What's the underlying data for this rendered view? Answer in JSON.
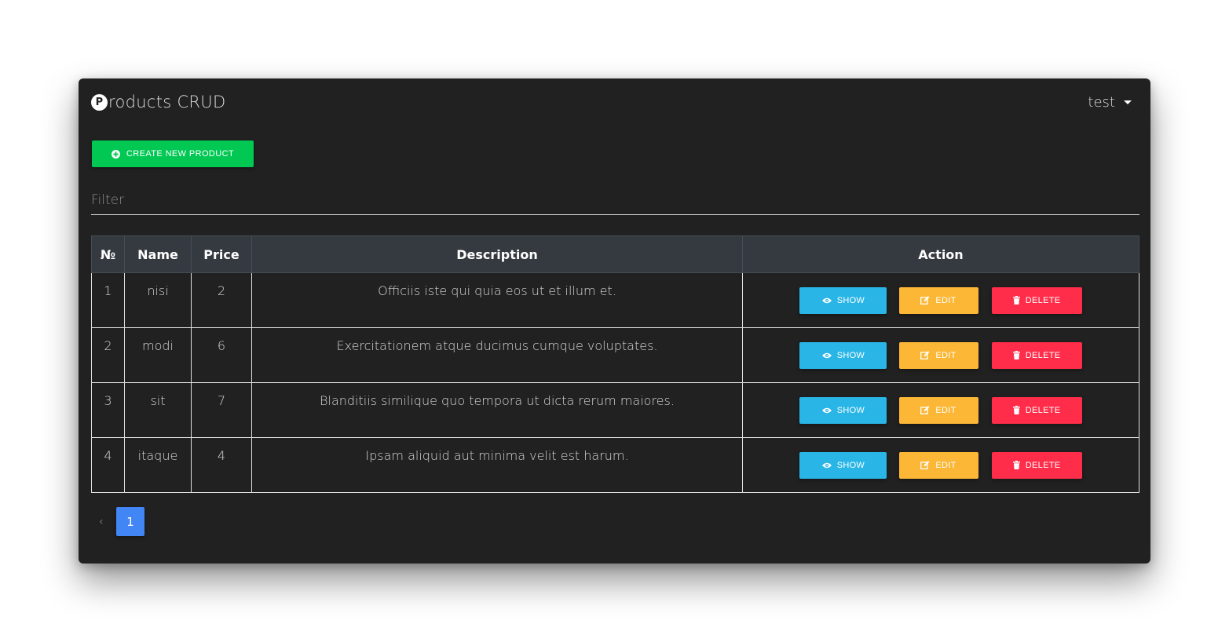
{
  "app": {
    "brand_logo_letter": "P",
    "brand_rest": "roducts CRUD",
    "user_label": "test"
  },
  "toolbar": {
    "create_label": "CREATE NEW PRODUCT"
  },
  "filter": {
    "placeholder": "Filter",
    "value": ""
  },
  "table": {
    "headers": [
      "№",
      "Name",
      "Price",
      "Description",
      "Action"
    ],
    "rows": [
      {
        "no": "1",
        "name": "nisi",
        "price": "2",
        "description": "Officiis iste qui quia eos ut et illum et."
      },
      {
        "no": "2",
        "name": "modi",
        "price": "6",
        "description": "Exercitationem atque ducimus cumque voluptates."
      },
      {
        "no": "3",
        "name": "sit",
        "price": "7",
        "description": "Blanditiis similique quo tempora ut dicta rerum maiores."
      },
      {
        "no": "4",
        "name": "itaque",
        "price": "4",
        "description": "Ipsam aliquid aut minima velit est harum."
      }
    ],
    "actions": {
      "show_label": "SHOW",
      "edit_label": "EDIT",
      "delete_label": "DELETE"
    }
  },
  "pagination": {
    "prev": "‹",
    "current_page": "1"
  },
  "icons": {
    "create": "plus-circle-icon",
    "show": "eye-icon",
    "edit": "edit-icon",
    "delete": "trash-icon",
    "user_menu": "caret-down-icon"
  },
  "colors": {
    "background": "#212121",
    "create": "#00c853",
    "show": "#29b6e6",
    "edit": "#fbb735",
    "delete": "#ff2d4a",
    "page_active": "#4285f4",
    "table_header": "#343a40"
  }
}
